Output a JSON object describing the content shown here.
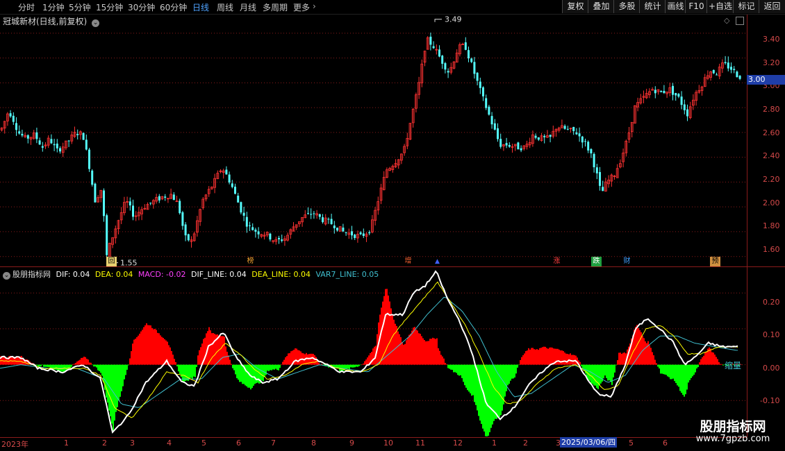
{
  "toolbar": {
    "periods": [
      "分时",
      "1分钟",
      "5分钟",
      "15分钟",
      "30分钟",
      "60分钟",
      "日线",
      "周线",
      "月线",
      "多周期",
      "更多"
    ],
    "active_period": "日线",
    "right_buttons": [
      "复权",
      "叠加",
      "多股",
      "统计",
      "画线",
      "F10",
      "+自选",
      "标记",
      "返回"
    ]
  },
  "stock_title": "冠城新材(日线,前复权)",
  "indicator_title": {
    "name": "股朋指标网",
    "dif": "DIF: 0.04",
    "dea": "DEA: 0.04",
    "macd": "MACD: -0.02",
    "dif_line": "DIF_LINE: 0.04",
    "dea_line": "DEA_LINE: 0.04",
    "var7_line": "VAR7_LINE: 0.05"
  },
  "price_axis": [
    "3.40",
    "3.20",
    "3.00",
    "2.80",
    "2.60",
    "2.40",
    "2.20",
    "2.00",
    "1.80",
    "1.60"
  ],
  "current_price": "3.00",
  "indicator_axis": [
    "0.20",
    "0.10",
    "0.00",
    "-0.10"
  ],
  "date_axis": {
    "months": [
      "2023年",
      "1",
      "2",
      "3",
      "4",
      "5",
      "6",
      "7",
      "8",
      "9",
      "10",
      "11",
      "12",
      "1",
      "2",
      "3",
      "5",
      "6"
    ],
    "selected_date": "2025/03/06/四"
  },
  "annotations": {
    "high": "3.49",
    "low": "1.55",
    "tag": "缩量"
  },
  "events": [
    "回",
    "榜",
    "增",
    "涨",
    "跌",
    "财",
    "预"
  ],
  "watermark": {
    "line1": "股朋指标网",
    "line2": "www.7gpzb.com"
  },
  "colors": {
    "up": "#ff3232",
    "down": "#54fcfc",
    "hist_pos": "#ff0000",
    "hist_neg": "#00ff00",
    "dif_line": "#ffffff",
    "dea_line": "#ffff00",
    "var7_line": "#40c0d0",
    "macd_text": "#ff40ff",
    "grid": "#8b1b1b"
  },
  "chart_data": [
    {
      "type": "candlestick",
      "ylim": [
        1.52,
        3.55
      ],
      "anchors": [
        [
          0,
          2.62
        ],
        [
          6,
          2.7
        ],
        [
          11,
          2.78
        ],
        [
          18,
          2.7
        ],
        [
          25,
          2.6
        ],
        [
          35,
          2.55
        ],
        [
          48,
          2.58
        ],
        [
          60,
          2.48
        ],
        [
          70,
          2.55
        ],
        [
          80,
          2.45
        ],
        [
          92,
          2.5
        ],
        [
          108,
          2.6
        ],
        [
          118,
          2.58
        ],
        [
          128,
          2.3
        ],
        [
          135,
          2.05
        ],
        [
          145,
          2.15
        ],
        [
          152,
          1.6
        ],
        [
          158,
          1.72
        ],
        [
          168,
          1.88
        ],
        [
          180,
          2.05
        ],
        [
          192,
          1.92
        ],
        [
          205,
          2.0
        ],
        [
          218,
          2.04
        ],
        [
          232,
          2.08
        ],
        [
          245,
          2.1
        ],
        [
          255,
          2.02
        ],
        [
          265,
          1.75
        ],
        [
          275,
          1.72
        ],
        [
          290,
          2.05
        ],
        [
          305,
          2.18
        ],
        [
          318,
          2.32
        ],
        [
          330,
          2.2
        ],
        [
          345,
          1.98
        ],
        [
          355,
          1.85
        ],
        [
          368,
          1.8
        ],
        [
          382,
          1.78
        ],
        [
          395,
          1.72
        ],
        [
          410,
          1.75
        ],
        [
          422,
          1.85
        ],
        [
          435,
          1.92
        ],
        [
          450,
          1.95
        ],
        [
          462,
          1.9
        ],
        [
          478,
          1.86
        ],
        [
          492,
          1.8
        ],
        [
          505,
          1.78
        ],
        [
          518,
          1.76
        ],
        [
          532,
          1.82
        ],
        [
          545,
          2.1
        ],
        [
          555,
          2.3
        ],
        [
          565,
          2.35
        ],
        [
          580,
          2.45
        ],
        [
          592,
          2.75
        ],
        [
          602,
          3.0
        ],
        [
          612,
          3.35
        ],
        [
          622,
          3.3
        ],
        [
          632,
          3.2
        ],
        [
          645,
          3.08
        ],
        [
          658,
          3.28
        ],
        [
          668,
          3.3
        ],
        [
          680,
          3.1
        ],
        [
          692,
          2.9
        ],
        [
          705,
          2.7
        ],
        [
          718,
          2.5
        ],
        [
          730,
          2.5
        ],
        [
          742,
          2.48
        ],
        [
          755,
          2.48
        ],
        [
          765,
          2.58
        ],
        [
          778,
          2.55
        ],
        [
          790,
          2.55
        ],
        [
          800,
          2.65
        ],
        [
          815,
          2.62
        ],
        [
          828,
          2.6
        ],
        [
          840,
          2.52
        ],
        [
          850,
          2.42
        ],
        [
          858,
          2.25
        ],
        [
          864,
          2.1
        ],
        [
          872,
          2.2
        ],
        [
          882,
          2.25
        ],
        [
          892,
          2.38
        ],
        [
          902,
          2.55
        ],
        [
          912,
          2.8
        ],
        [
          925,
          2.88
        ],
        [
          938,
          2.95
        ],
        [
          950,
          2.92
        ],
        [
          962,
          2.95
        ],
        [
          975,
          2.88
        ],
        [
          988,
          2.75
        ],
        [
          998,
          2.9
        ],
        [
          1010,
          3.0
        ],
        [
          1020,
          3.1
        ],
        [
          1030,
          3.08
        ],
        [
          1040,
          3.15
        ],
        [
          1050,
          3.12
        ],
        [
          1062,
          3.05
        ]
      ],
      "high": 3.49,
      "low": 1.55
    },
    {
      "type": "macd",
      "ylim": [
        -0.2,
        0.27
      ],
      "dif": [
        [
          0,
          0.02
        ],
        [
          30,
          0.02
        ],
        [
          55,
          -0.01
        ],
        [
          90,
          -0.02
        ],
        [
          120,
          0.0
        ],
        [
          145,
          -0.04
        ],
        [
          162,
          -0.19
        ],
        [
          185,
          -0.14
        ],
        [
          210,
          -0.05
        ],
        [
          240,
          0.01
        ],
        [
          262,
          -0.05
        ],
        [
          280,
          -0.06
        ],
        [
          300,
          0.05
        ],
        [
          322,
          0.09
        ],
        [
          340,
          0.02
        ],
        [
          360,
          -0.03
        ],
        [
          378,
          -0.05
        ],
        [
          400,
          -0.04
        ],
        [
          425,
          0.01
        ],
        [
          450,
          0.02
        ],
        [
          470,
          0.0
        ],
        [
          490,
          -0.02
        ],
        [
          520,
          -0.02
        ],
        [
          540,
          0.02
        ],
        [
          555,
          0.14
        ],
        [
          568,
          0.14
        ],
        [
          580,
          0.14
        ],
        [
          595,
          0.2
        ],
        [
          612,
          0.22
        ],
        [
          628,
          0.26
        ],
        [
          645,
          0.18
        ],
        [
          662,
          0.12
        ],
        [
          680,
          0.03
        ],
        [
          700,
          -0.11
        ],
        [
          720,
          -0.15
        ],
        [
          740,
          -0.12
        ],
        [
          760,
          -0.06
        ],
        [
          780,
          -0.02
        ],
        [
          800,
          0.01
        ],
        [
          830,
          0.01
        ],
        [
          845,
          -0.04
        ],
        [
          860,
          -0.08
        ],
        [
          880,
          -0.09
        ],
        [
          900,
          0.0
        ],
        [
          915,
          0.1
        ],
        [
          932,
          0.13
        ],
        [
          950,
          0.1
        ],
        [
          970,
          0.06
        ],
        [
          985,
          0.0
        ],
        [
          1000,
          0.02
        ],
        [
          1020,
          0.06
        ],
        [
          1040,
          0.05
        ],
        [
          1060,
          0.05
        ]
      ],
      "dea": [
        [
          0,
          0.01
        ],
        [
          30,
          0.01
        ],
        [
          60,
          -0.01
        ],
        [
          90,
          -0.01
        ],
        [
          120,
          -0.01
        ],
        [
          145,
          -0.03
        ],
        [
          165,
          -0.12
        ],
        [
          190,
          -0.15
        ],
        [
          215,
          -0.09
        ],
        [
          240,
          -0.02
        ],
        [
          265,
          -0.03
        ],
        [
          285,
          -0.05
        ],
        [
          305,
          0.02
        ],
        [
          325,
          0.06
        ],
        [
          345,
          0.03
        ],
        [
          365,
          -0.01
        ],
        [
          385,
          -0.04
        ],
        [
          410,
          -0.03
        ],
        [
          435,
          0.0
        ],
        [
          460,
          0.01
        ],
        [
          485,
          -0.01
        ],
        [
          520,
          -0.02
        ],
        [
          545,
          0.0
        ],
        [
          565,
          0.08
        ],
        [
          590,
          0.14
        ],
        [
          612,
          0.19
        ],
        [
          630,
          0.23
        ],
        [
          650,
          0.17
        ],
        [
          670,
          0.11
        ],
        [
          690,
          0.03
        ],
        [
          710,
          -0.06
        ],
        [
          730,
          -0.11
        ],
        [
          750,
          -0.1
        ],
        [
          775,
          -0.05
        ],
        [
          800,
          -0.01
        ],
        [
          830,
          0.0
        ],
        [
          850,
          -0.03
        ],
        [
          870,
          -0.07
        ],
        [
          890,
          -0.06
        ],
        [
          910,
          0.03
        ],
        [
          930,
          0.1
        ],
        [
          950,
          0.11
        ],
        [
          970,
          0.08
        ],
        [
          990,
          0.03
        ],
        [
          1010,
          0.03
        ],
        [
          1035,
          0.05
        ],
        [
          1060,
          0.05
        ]
      ],
      "var7": [
        [
          0,
          -0.01
        ],
        [
          30,
          0.0
        ],
        [
          70,
          -0.01
        ],
        [
          110,
          -0.01
        ],
        [
          150,
          -0.04
        ],
        [
          175,
          -0.11
        ],
        [
          200,
          -0.12
        ],
        [
          230,
          -0.08
        ],
        [
          260,
          -0.04
        ],
        [
          290,
          -0.04
        ],
        [
          320,
          0.02
        ],
        [
          345,
          0.03
        ],
        [
          370,
          -0.01
        ],
        [
          400,
          -0.04
        ],
        [
          430,
          -0.02
        ],
        [
          460,
          0.0
        ],
        [
          490,
          -0.01
        ],
        [
          530,
          -0.02
        ],
        [
          560,
          0.03
        ],
        [
          590,
          0.08
        ],
        [
          615,
          0.14
        ],
        [
          640,
          0.19
        ],
        [
          665,
          0.15
        ],
        [
          690,
          0.08
        ],
        [
          715,
          -0.02
        ],
        [
          740,
          -0.09
        ],
        [
          765,
          -0.08
        ],
        [
          795,
          -0.04
        ],
        [
          825,
          0.0
        ],
        [
          850,
          -0.02
        ],
        [
          875,
          -0.05
        ],
        [
          900,
          -0.03
        ],
        [
          925,
          0.04
        ],
        [
          950,
          0.08
        ],
        [
          975,
          0.08
        ],
        [
          1000,
          0.06
        ],
        [
          1030,
          0.05
        ],
        [
          1060,
          0.04
        ]
      ]
    }
  ]
}
